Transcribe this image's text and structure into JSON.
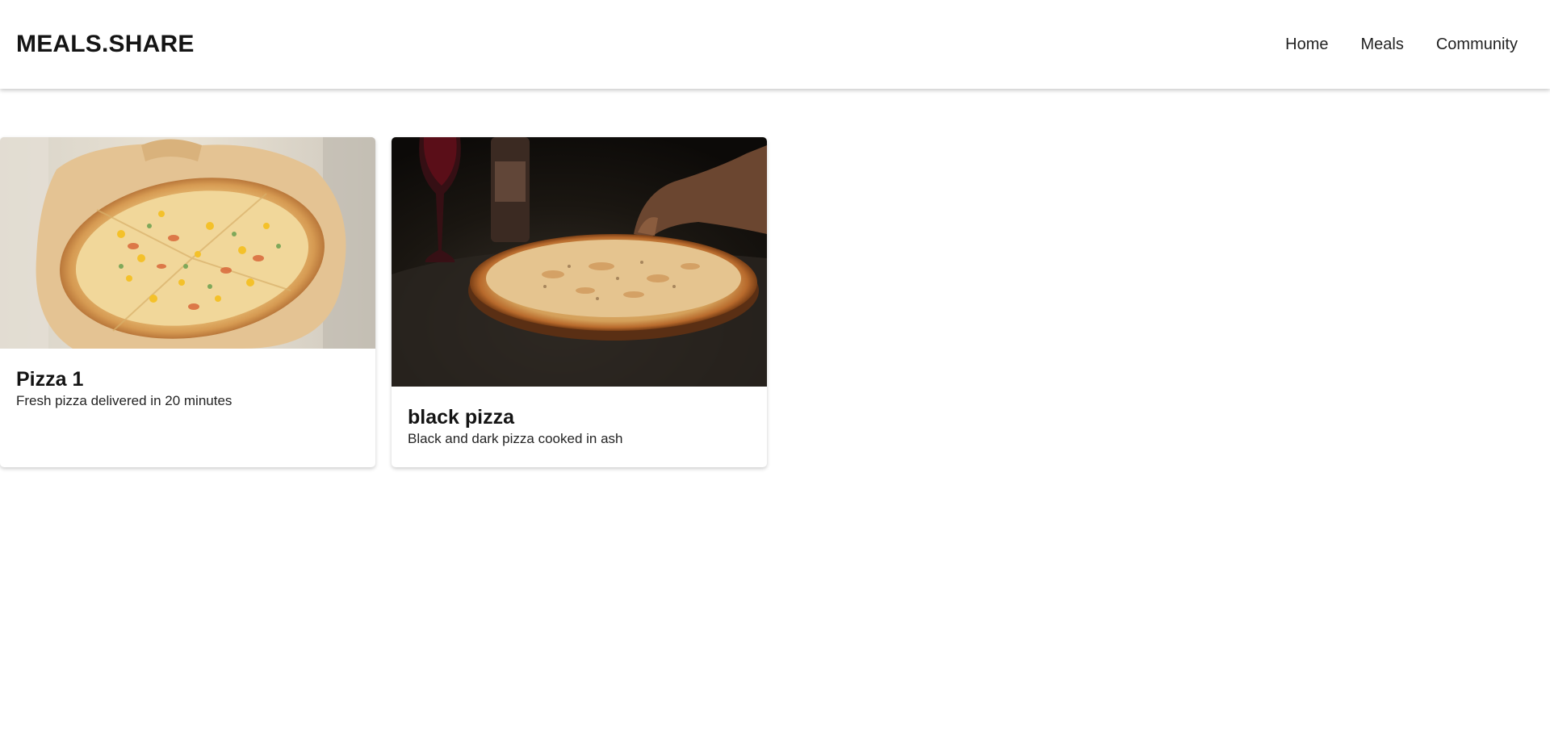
{
  "header": {
    "brand": "MEALS.SHARE",
    "nav": [
      {
        "label": "Home"
      },
      {
        "label": "Meals"
      },
      {
        "label": "Community"
      }
    ]
  },
  "meals": [
    {
      "title": "Pizza 1",
      "description": "Fresh pizza delivered in 20 minutes",
      "image_alt": "Pizza with corn and peppers on a wooden board"
    },
    {
      "title": "black pizza",
      "description": "Black and dark pizza cooked in ash",
      "image_alt": "Pizza on a dark table with a wine glass and bottle"
    }
  ],
  "colors": {
    "text": "#141414",
    "background": "#ffffff"
  }
}
